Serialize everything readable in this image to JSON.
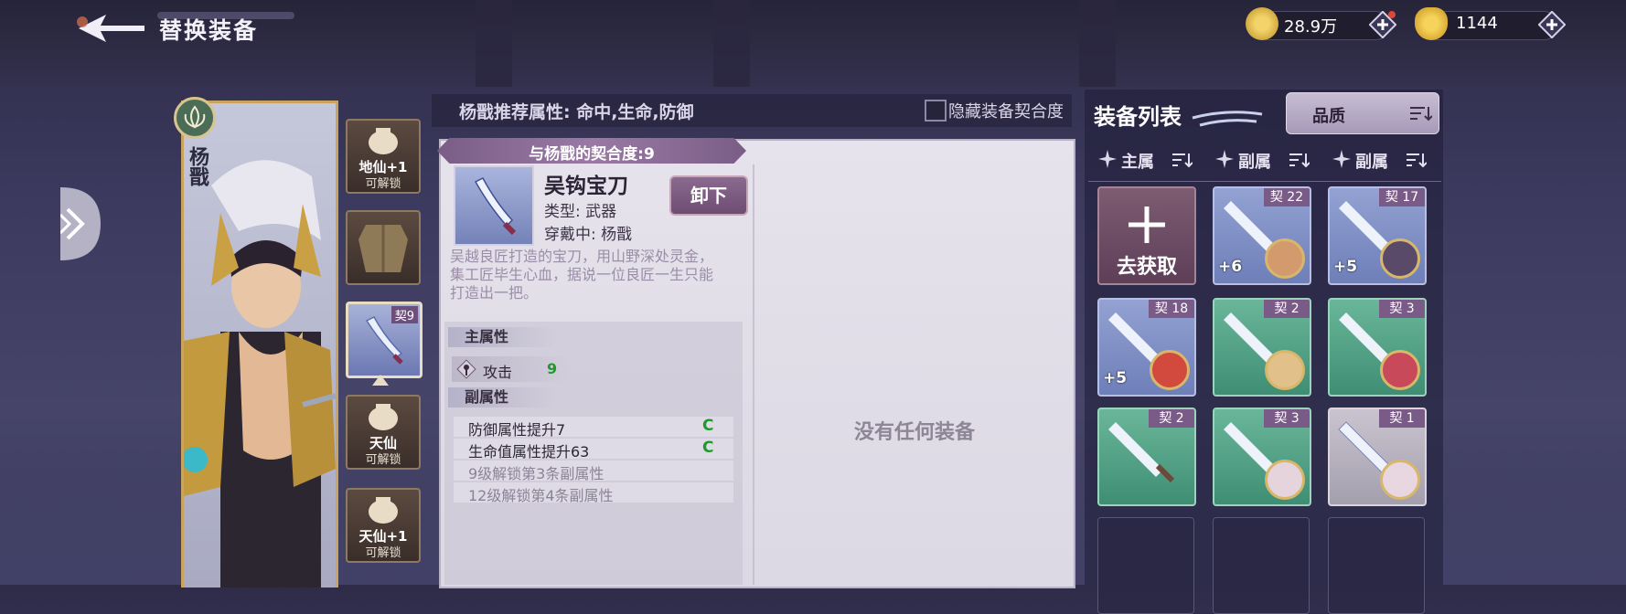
{
  "header": {
    "title": "替换装备",
    "gold": "28.9万",
    "ingot": "1144"
  },
  "hero": {
    "name": "杨戬"
  },
  "slots": [
    {
      "label": "地仙+1",
      "status": "可解锁"
    },
    {
      "label": "",
      "status": ""
    },
    {
      "tag": "契9"
    },
    {
      "label": "天仙",
      "status": "可解锁"
    },
    {
      "label": "天仙+1",
      "status": "可解锁"
    }
  ],
  "recommend": {
    "text": "杨戬推荐属性: 命中,生命,防御",
    "hide_label": "隐藏装备契合度"
  },
  "detail": {
    "fit": "与杨戬的契合度:9",
    "name": "吴钩宝刀",
    "type": "类型: 武器",
    "worn": "穿戴中: 杨戬",
    "unequip": "卸下",
    "desc": "吴越良匠打造的宝刀，用山野深处灵金，集工匠毕生心血，据说一位良匠一生只能打造出一把。",
    "main_head": "主属性",
    "main_name": "攻击",
    "main_value": "9",
    "sub_head": "副属性",
    "subs": [
      "防御属性提升7",
      "生命值属性提升63",
      "9级解锁第3条副属性",
      "12级解锁第4条副属性"
    ],
    "empty": "没有任何装备"
  },
  "list": {
    "title": "装备列表",
    "quality": "品质",
    "filters": [
      "主属",
      "副属",
      "副属"
    ],
    "get_label": "去获取",
    "items": [
      {
        "tag": "契 22",
        "plus": "+6",
        "color": "blue"
      },
      {
        "tag": "契 17",
        "plus": "+5",
        "color": "blue"
      },
      {
        "tag": "契 18",
        "plus": "+5",
        "color": "blue"
      },
      {
        "tag": "契 2",
        "plus": "",
        "color": "green"
      },
      {
        "tag": "契 3",
        "plus": "",
        "color": "green"
      },
      {
        "tag": "契 2",
        "plus": "",
        "color": "green"
      },
      {
        "tag": "契 3",
        "plus": "",
        "color": "green"
      },
      {
        "tag": "契 1",
        "plus": "",
        "color": "grey"
      }
    ]
  },
  "colors": {
    "accent_purple": "#7a5a86",
    "stat_green": "#1e9a2c",
    "gold_frame": "#c9a45c"
  }
}
